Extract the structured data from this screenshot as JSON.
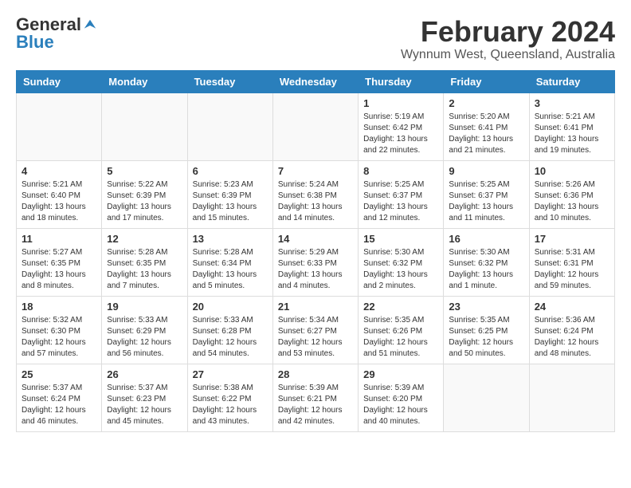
{
  "logo": {
    "general": "General",
    "blue": "Blue"
  },
  "title": "February 2024",
  "location": "Wynnum West, Queensland, Australia",
  "days_of_week": [
    "Sunday",
    "Monday",
    "Tuesday",
    "Wednesday",
    "Thursday",
    "Friday",
    "Saturday"
  ],
  "weeks": [
    [
      {
        "day": "",
        "sunrise": "",
        "sunset": "",
        "daylight": "",
        "empty": true
      },
      {
        "day": "",
        "sunrise": "",
        "sunset": "",
        "daylight": "",
        "empty": true
      },
      {
        "day": "",
        "sunrise": "",
        "sunset": "",
        "daylight": "",
        "empty": true
      },
      {
        "day": "",
        "sunrise": "",
        "sunset": "",
        "daylight": "",
        "empty": true
      },
      {
        "day": "1",
        "sunrise": "Sunrise: 5:19 AM",
        "sunset": "Sunset: 6:42 PM",
        "daylight": "Daylight: 13 hours and 22 minutes.",
        "empty": false
      },
      {
        "day": "2",
        "sunrise": "Sunrise: 5:20 AM",
        "sunset": "Sunset: 6:41 PM",
        "daylight": "Daylight: 13 hours and 21 minutes.",
        "empty": false
      },
      {
        "day": "3",
        "sunrise": "Sunrise: 5:21 AM",
        "sunset": "Sunset: 6:41 PM",
        "daylight": "Daylight: 13 hours and 19 minutes.",
        "empty": false
      }
    ],
    [
      {
        "day": "4",
        "sunrise": "Sunrise: 5:21 AM",
        "sunset": "Sunset: 6:40 PM",
        "daylight": "Daylight: 13 hours and 18 minutes.",
        "empty": false
      },
      {
        "day": "5",
        "sunrise": "Sunrise: 5:22 AM",
        "sunset": "Sunset: 6:39 PM",
        "daylight": "Daylight: 13 hours and 17 minutes.",
        "empty": false
      },
      {
        "day": "6",
        "sunrise": "Sunrise: 5:23 AM",
        "sunset": "Sunset: 6:39 PM",
        "daylight": "Daylight: 13 hours and 15 minutes.",
        "empty": false
      },
      {
        "day": "7",
        "sunrise": "Sunrise: 5:24 AM",
        "sunset": "Sunset: 6:38 PM",
        "daylight": "Daylight: 13 hours and 14 minutes.",
        "empty": false
      },
      {
        "day": "8",
        "sunrise": "Sunrise: 5:25 AM",
        "sunset": "Sunset: 6:37 PM",
        "daylight": "Daylight: 13 hours and 12 minutes.",
        "empty": false
      },
      {
        "day": "9",
        "sunrise": "Sunrise: 5:25 AM",
        "sunset": "Sunset: 6:37 PM",
        "daylight": "Daylight: 13 hours and 11 minutes.",
        "empty": false
      },
      {
        "day": "10",
        "sunrise": "Sunrise: 5:26 AM",
        "sunset": "Sunset: 6:36 PM",
        "daylight": "Daylight: 13 hours and 10 minutes.",
        "empty": false
      }
    ],
    [
      {
        "day": "11",
        "sunrise": "Sunrise: 5:27 AM",
        "sunset": "Sunset: 6:35 PM",
        "daylight": "Daylight: 13 hours and 8 minutes.",
        "empty": false
      },
      {
        "day": "12",
        "sunrise": "Sunrise: 5:28 AM",
        "sunset": "Sunset: 6:35 PM",
        "daylight": "Daylight: 13 hours and 7 minutes.",
        "empty": false
      },
      {
        "day": "13",
        "sunrise": "Sunrise: 5:28 AM",
        "sunset": "Sunset: 6:34 PM",
        "daylight": "Daylight: 13 hours and 5 minutes.",
        "empty": false
      },
      {
        "day": "14",
        "sunrise": "Sunrise: 5:29 AM",
        "sunset": "Sunset: 6:33 PM",
        "daylight": "Daylight: 13 hours and 4 minutes.",
        "empty": false
      },
      {
        "day": "15",
        "sunrise": "Sunrise: 5:30 AM",
        "sunset": "Sunset: 6:32 PM",
        "daylight": "Daylight: 13 hours and 2 minutes.",
        "empty": false
      },
      {
        "day": "16",
        "sunrise": "Sunrise: 5:30 AM",
        "sunset": "Sunset: 6:32 PM",
        "daylight": "Daylight: 13 hours and 1 minute.",
        "empty": false
      },
      {
        "day": "17",
        "sunrise": "Sunrise: 5:31 AM",
        "sunset": "Sunset: 6:31 PM",
        "daylight": "Daylight: 12 hours and 59 minutes.",
        "empty": false
      }
    ],
    [
      {
        "day": "18",
        "sunrise": "Sunrise: 5:32 AM",
        "sunset": "Sunset: 6:30 PM",
        "daylight": "Daylight: 12 hours and 57 minutes.",
        "empty": false
      },
      {
        "day": "19",
        "sunrise": "Sunrise: 5:33 AM",
        "sunset": "Sunset: 6:29 PM",
        "daylight": "Daylight: 12 hours and 56 minutes.",
        "empty": false
      },
      {
        "day": "20",
        "sunrise": "Sunrise: 5:33 AM",
        "sunset": "Sunset: 6:28 PM",
        "daylight": "Daylight: 12 hours and 54 minutes.",
        "empty": false
      },
      {
        "day": "21",
        "sunrise": "Sunrise: 5:34 AM",
        "sunset": "Sunset: 6:27 PM",
        "daylight": "Daylight: 12 hours and 53 minutes.",
        "empty": false
      },
      {
        "day": "22",
        "sunrise": "Sunrise: 5:35 AM",
        "sunset": "Sunset: 6:26 PM",
        "daylight": "Daylight: 12 hours and 51 minutes.",
        "empty": false
      },
      {
        "day": "23",
        "sunrise": "Sunrise: 5:35 AM",
        "sunset": "Sunset: 6:25 PM",
        "daylight": "Daylight: 12 hours and 50 minutes.",
        "empty": false
      },
      {
        "day": "24",
        "sunrise": "Sunrise: 5:36 AM",
        "sunset": "Sunset: 6:24 PM",
        "daylight": "Daylight: 12 hours and 48 minutes.",
        "empty": false
      }
    ],
    [
      {
        "day": "25",
        "sunrise": "Sunrise: 5:37 AM",
        "sunset": "Sunset: 6:24 PM",
        "daylight": "Daylight: 12 hours and 46 minutes.",
        "empty": false
      },
      {
        "day": "26",
        "sunrise": "Sunrise: 5:37 AM",
        "sunset": "Sunset: 6:23 PM",
        "daylight": "Daylight: 12 hours and 45 minutes.",
        "empty": false
      },
      {
        "day": "27",
        "sunrise": "Sunrise: 5:38 AM",
        "sunset": "Sunset: 6:22 PM",
        "daylight": "Daylight: 12 hours and 43 minutes.",
        "empty": false
      },
      {
        "day": "28",
        "sunrise": "Sunrise: 5:39 AM",
        "sunset": "Sunset: 6:21 PM",
        "daylight": "Daylight: 12 hours and 42 minutes.",
        "empty": false
      },
      {
        "day": "29",
        "sunrise": "Sunrise: 5:39 AM",
        "sunset": "Sunset: 6:20 PM",
        "daylight": "Daylight: 12 hours and 40 minutes.",
        "empty": false
      },
      {
        "day": "",
        "sunrise": "",
        "sunset": "",
        "daylight": "",
        "empty": true
      },
      {
        "day": "",
        "sunrise": "",
        "sunset": "",
        "daylight": "",
        "empty": true
      }
    ]
  ]
}
